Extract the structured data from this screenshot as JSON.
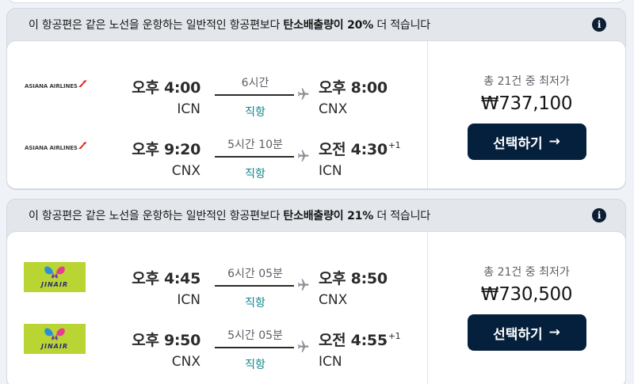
{
  "offers": [
    {
      "eco_prefix": "이 항공편은 같은 노선을 운항하는 일반적인 항공편보다 ",
      "eco_bold": "탄소배출량이 20%",
      "eco_suffix": " 더 적습니다",
      "info_icon": "i",
      "airline_logo_text": "ASIANA AIRLINES",
      "legs": [
        {
          "dep_time": "오후 4:00",
          "dep_code": "ICN",
          "duration": "6시간",
          "stops": "직항",
          "arr_time": "오후 8:00",
          "arr_day_offset": "",
          "arr_code": "CNX"
        },
        {
          "dep_time": "오후 9:20",
          "dep_code": "CNX",
          "duration": "5시간 10분",
          "stops": "직항",
          "arr_time": "오전 4:30",
          "arr_day_offset": "+1",
          "arr_code": "ICN"
        }
      ],
      "total_text": "총 21건 중 최저가",
      "price": "₩737,100",
      "button_label": "선택하기",
      "button_arrow": "→"
    },
    {
      "eco_prefix": "이 항공편은 같은 노선을 운항하는 일반적인 항공편보다 ",
      "eco_bold": "탄소배출량이 21%",
      "eco_suffix": " 더 적습니다",
      "info_icon": "i",
      "airline_logo_text": "JINAIR",
      "legs": [
        {
          "dep_time": "오후 4:45",
          "dep_code": "ICN",
          "duration": "6시간 05분",
          "stops": "직항",
          "arr_time": "오후 8:50",
          "arr_day_offset": "",
          "arr_code": "CNX"
        },
        {
          "dep_time": "오후 9:50",
          "dep_code": "CNX",
          "duration": "5시간 05분",
          "stops": "직항",
          "arr_time": "오전 4:55",
          "arr_day_offset": "+1",
          "arr_code": "ICN"
        }
      ],
      "total_text": "총 21건 중 최저가",
      "price": "₩730,500",
      "button_label": "선택하기",
      "button_arrow": "→"
    }
  ],
  "colors": {
    "accent_button": "#05203c",
    "stops_text": "#0c838a",
    "asiana_red": "#e2231a",
    "jinair_green": "#b9d534"
  }
}
